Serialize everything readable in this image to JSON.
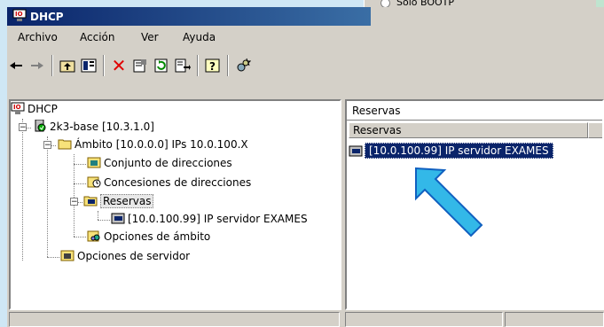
{
  "window": {
    "title": "DHCP"
  },
  "background_dialog": {
    "radio_label": "Sólo BOOTP"
  },
  "menu": {
    "items": [
      {
        "label": "Archivo"
      },
      {
        "label": "Acción"
      },
      {
        "label": "Ver"
      },
      {
        "label": "Ayuda"
      }
    ]
  },
  "toolbar": {
    "icons": [
      "back-arrow-icon",
      "forward-arrow-icon",
      "up-folder-icon",
      "show-hide-tree-icon",
      "delete-icon",
      "properties-icon",
      "refresh-icon",
      "export-list-icon",
      "help-icon",
      "wizard-icon"
    ]
  },
  "tree": {
    "root": "DHCP",
    "server": "2k3-base [10.3.1.0]",
    "scope": "Ámbito [10.0.0.0] IPs 10.0.100.X",
    "address_pool": "Conjunto de direcciones",
    "leases": "Concesiones de direcciones",
    "reservations": "Reservas",
    "reservation_item": "[10.0.100.99] IP servidor EXAMES",
    "scope_options": "Opciones de ámbito",
    "server_options": "Opciones de servidor"
  },
  "details": {
    "title": "Reservas",
    "column_header": "Reservas",
    "rows": [
      {
        "label": "[10.0.100.99] IP servidor EXAMES"
      }
    ]
  },
  "colors": {
    "titlebar_start": "#0a246a",
    "selection": "#0a246a",
    "arrow": "#33b8e8",
    "window_face": "#d4d0c8"
  }
}
